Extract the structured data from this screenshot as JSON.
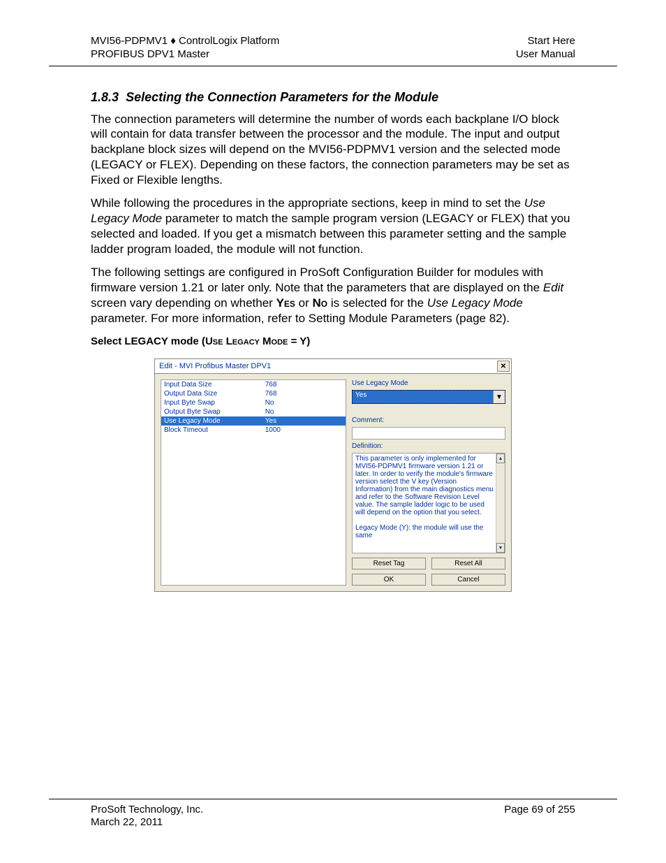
{
  "header": {
    "left_line1": "MVI56-PDPMV1 ♦ ControlLogix Platform",
    "left_line2": "PROFIBUS DPV1 Master",
    "right_line1": "Start Here",
    "right_line2": "User Manual"
  },
  "section": {
    "number": "1.8.3",
    "title": "Selecting the Connection Parameters for the Module"
  },
  "paragraphs": {
    "p1": "The connection parameters will determine the number of words each backplane I/O block will contain for data transfer between the processor and the module. The input and output backplane block sizes will depend on the MVI56-PDPMV1 version and the selected mode (LEGACY or FLEX). Depending on these factors, the connection parameters may be set as Fixed or Flexible lengths.",
    "p2a": "While following the procedures in the appropriate sections, keep in mind to set the ",
    "p2_i": "Use Legacy Mode",
    "p2b": " parameter to match the sample program version (LEGACY or FLEX) that you selected and loaded. If you get a mismatch between this parameter setting and the sample ladder program loaded, the module will not function.",
    "p3a": "The following settings are configured in ProSoft Configuration Builder for modules with firmware version 1.21 or later only. Note that the parameters that are displayed on the ",
    "p3_i1": "Edit",
    "p3b": " screen vary depending on whether ",
    "p3_sc1": "Yes",
    "p3c": " or ",
    "p3_sc2": "No",
    "p3d": " is selected for the ",
    "p3_i2": "Use Legacy Mode",
    "p3e": " parameter. For more information, refer to Setting Module Parameters (page 82)."
  },
  "subhead": {
    "a": "Select LEGACY mode (",
    "sc": "Use Legacy Mode",
    "b": " = Y)"
  },
  "dialog": {
    "title": "Edit - MVI Profibus Master DPV1",
    "params": [
      {
        "name": "Input Data Size",
        "value": "768",
        "selected": false
      },
      {
        "name": "Output Data Size",
        "value": "768",
        "selected": false
      },
      {
        "name": "Input Byte Swap",
        "value": "No",
        "selected": false
      },
      {
        "name": "Output Byte Swap",
        "value": "No",
        "selected": false
      },
      {
        "name": "Use Legacy Mode",
        "value": "Yes",
        "selected": true
      },
      {
        "name": "Block Timeout",
        "value": "1000",
        "selected": false
      }
    ],
    "right": {
      "label": "Use Legacy Mode",
      "value": "Yes",
      "comment_label": "Comment:",
      "definition_label": "Definition:",
      "definition_text": "This parameter is only implemented for MVI56-PDPMV1 firmware version 1.21 or later. In order to verify the module's firmware version select the V key (Version Information) from the main diagnostics menu and refer to the Software Revision Level value. The sample ladder logic to be used will depend on the option that you select.\n\nLegacy Mode (Y):  the module will use the same",
      "reset_tag": "Reset Tag",
      "reset_all": "Reset All",
      "ok": "OK",
      "cancel": "Cancel"
    }
  },
  "footer": {
    "left_line1": "ProSoft Technology, Inc.",
    "left_line2": "March 22, 2011",
    "right": "Page 69 of 255"
  }
}
